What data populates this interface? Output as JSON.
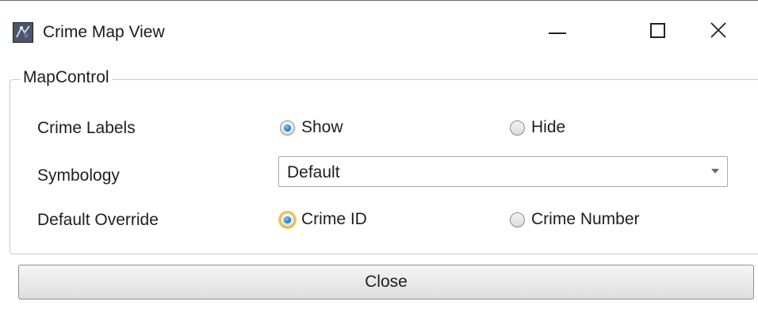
{
  "window": {
    "title": "Crime Map View",
    "app_icon": "crime-map-app-icon",
    "caption_buttons": [
      "minimize",
      "maximize",
      "close"
    ]
  },
  "group": {
    "legend": "MapControl"
  },
  "crime_labels": {
    "label": "Crime Labels",
    "options": [
      {
        "label": "Show",
        "checked": true
      },
      {
        "label": "Hide",
        "checked": false
      }
    ]
  },
  "symbology": {
    "label": "Symbology",
    "selected": "Default"
  },
  "default_override": {
    "label": "Default Override",
    "options": [
      {
        "label": "Crime ID",
        "checked": true,
        "focused": true
      },
      {
        "label": "Crime Number",
        "checked": false
      }
    ]
  },
  "footer": {
    "close_label": "Close"
  },
  "colors": {
    "radio_checked": "#1b6fb3",
    "focus_ring": "#f1c75a",
    "group_border": "#c8c8c8"
  }
}
